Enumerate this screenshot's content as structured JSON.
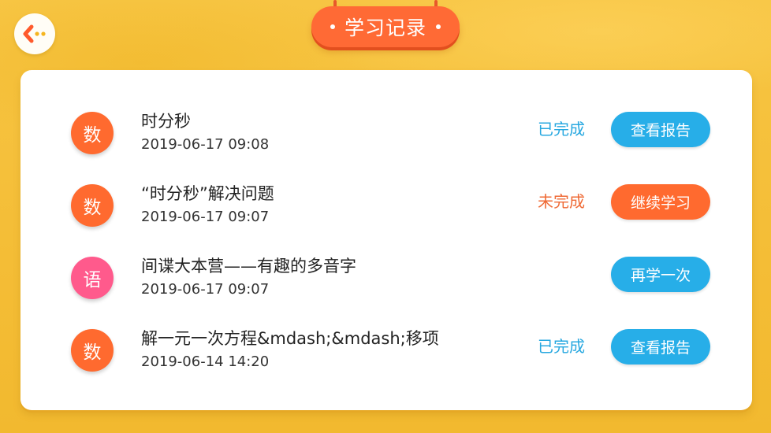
{
  "header": {
    "title": "学习记录",
    "back_icon": "back-arrow-icon"
  },
  "colors": {
    "background": "#f6c541",
    "title_pill": "#ff6a35",
    "math_badge": "#ff6a2f",
    "chinese_badge": "#ff5a8c",
    "done_text": "#28a8e0",
    "todo_text": "#ef6a35",
    "button_blue": "#27aee8",
    "button_orange": "#ff6a2f"
  },
  "records": [
    {
      "subject": "数",
      "subject_color": "#ff6a2f",
      "title": "时分秒",
      "time": "2019-06-17 09:08",
      "status": "已完成",
      "status_color": "#28a8e0",
      "action": "查看报告",
      "action_color": "#27aee8"
    },
    {
      "subject": "数",
      "subject_color": "#ff6a2f",
      "title": "“时分秒”解决问题",
      "time": "2019-06-17 09:07",
      "status": "未完成",
      "status_color": "#ef6a35",
      "action": "继续学习",
      "action_color": "#ff6a2f"
    },
    {
      "subject": "语",
      "subject_color": "#ff5a8c",
      "title": "间谍大本营——有趣的多音字",
      "time": "2019-06-17 09:07",
      "status": "",
      "status_color": "#28a8e0",
      "action": "再学一次",
      "action_color": "#27aee8"
    },
    {
      "subject": "数",
      "subject_color": "#ff6a2f",
      "title": "解一元一次方程&mdash;&mdash;移项",
      "time": "2019-06-14 14:20",
      "status": "已完成",
      "status_color": "#28a8e0",
      "action": "查看报告",
      "action_color": "#27aee8"
    }
  ]
}
